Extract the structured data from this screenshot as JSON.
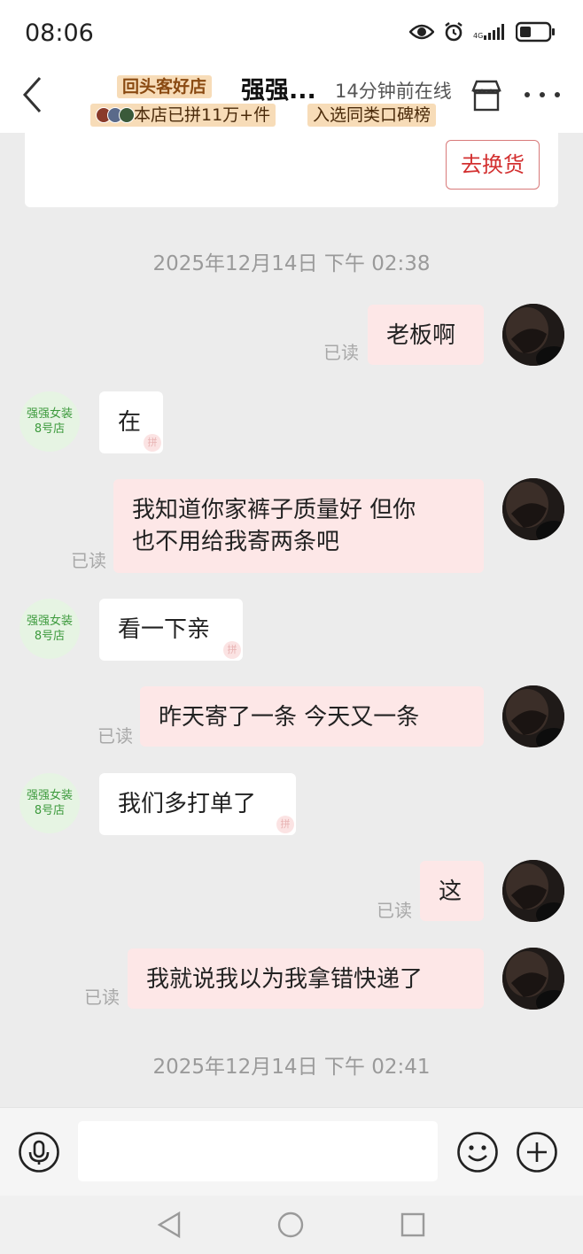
{
  "status": {
    "time": "08:06"
  },
  "header": {
    "badge": "回头客好店",
    "store_name": "强强...",
    "online": "14分钟前在线",
    "stats": "本店已拼11万+件",
    "rank": "入选同类口碑榜"
  },
  "order_card": {
    "button_label": "去换货"
  },
  "shop_avatar": {
    "line1": "强强女装",
    "line2": "8号店"
  },
  "read_label": "已读",
  "messages": [
    {
      "timestamp": "2025年12月14日 下午 02:38"
    },
    {
      "from": "me",
      "text": "老板啊"
    },
    {
      "from": "shop",
      "text": "在"
    },
    {
      "from": "me",
      "line1": "我知道你家裤子质量好  但你",
      "line2": "也不用给我寄两条吧"
    },
    {
      "from": "shop",
      "text": "看一下亲"
    },
    {
      "from": "me",
      "text": "昨天寄了一条  今天又一条"
    },
    {
      "from": "shop",
      "text": "我们多打单了"
    },
    {
      "from": "me",
      "text": "这"
    },
    {
      "from": "me",
      "text": "我就说我以为我拿错快递了"
    },
    {
      "timestamp": "2025年12月14日 下午 02:41"
    }
  ],
  "input": {
    "placeholder": ""
  },
  "colors": {
    "accent": "#d33030",
    "outgoing_bubble": "#fde7e7",
    "badge_bg": "#f7dcb8"
  },
  "icons": [
    "eye-icon",
    "alarm-icon",
    "signal-icon",
    "battery-icon",
    "back-icon",
    "store-icon",
    "more-icon",
    "microphone-icon",
    "emoji-icon",
    "plus-icon",
    "nav-back-icon",
    "nav-home-icon",
    "nav-recents-icon"
  ]
}
